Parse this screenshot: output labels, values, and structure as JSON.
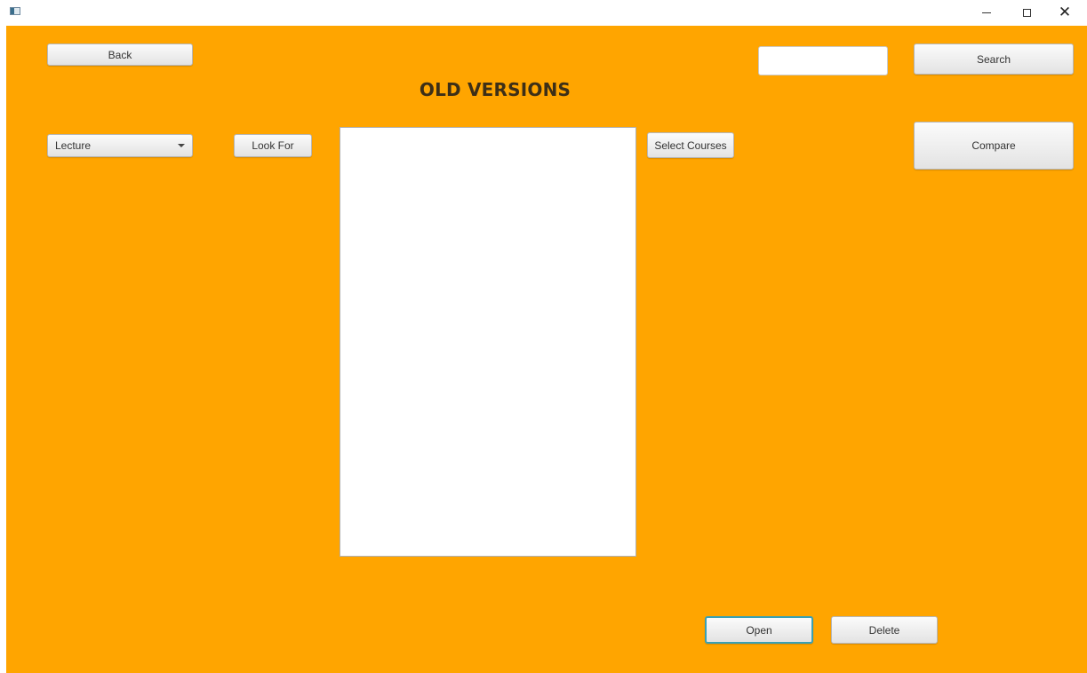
{
  "window": {
    "app_icon": "app-window-icon",
    "controls": {
      "minimize_icon": "minimize-icon",
      "maximize_icon": "maximize-icon",
      "close_icon": "close-icon",
      "close_glyph": "✕"
    }
  },
  "colors": {
    "background": "#ffa500",
    "title_text": "#3d2f17",
    "focus_border": "#39a0b4"
  },
  "toolbar": {
    "back_label": "Back",
    "search_label": "Search",
    "search_value": "",
    "compare_label": "Compare"
  },
  "page": {
    "title": "OLD VERSIONS"
  },
  "filter": {
    "type_selected": "Lecture",
    "look_for_label": "Look For",
    "select_courses_label": "Select Courses"
  },
  "list": {
    "items": []
  },
  "actions": {
    "open_label": "Open",
    "delete_label": "Delete"
  }
}
